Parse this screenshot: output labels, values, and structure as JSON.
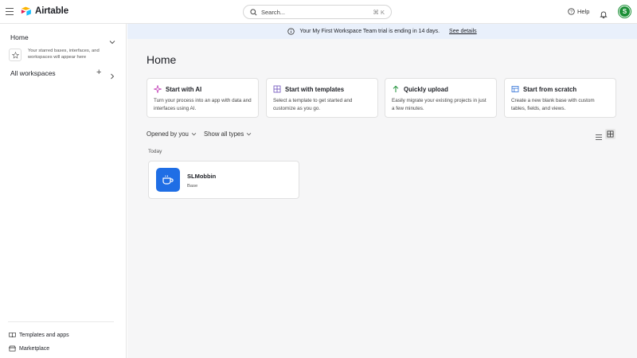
{
  "app": {
    "name": "Airtable"
  },
  "header": {
    "search_placeholder": "Search...",
    "search_shortcut": "⌘ K",
    "help_label": "Help",
    "avatar_initial": "S"
  },
  "sidebar": {
    "home_label": "Home",
    "starred_hint": "Your starred bases, interfaces, and workspaces will appear here",
    "all_workspaces_label": "All workspaces",
    "bottom_links": [
      {
        "label": "Templates and apps",
        "icon": "book-icon"
      },
      {
        "label": "Marketplace",
        "icon": "storefront-icon"
      }
    ]
  },
  "banner": {
    "text": "Your My First Workspace Team trial is ending in 14 days.",
    "link": "See details"
  },
  "main": {
    "title": "Home",
    "cards": [
      {
        "title": "Start with AI",
        "desc": "Turn your process into an app with data and interfaces using AI.",
        "icon": "sparkle-icon"
      },
      {
        "title": "Start with templates",
        "desc": "Select a template to get started and customize as you go.",
        "icon": "grid-icon"
      },
      {
        "title": "Quickly upload",
        "desc": "Easily migrate your existing projects in just a few minutes.",
        "icon": "arrow-up-icon"
      },
      {
        "title": "Start from scratch",
        "desc": "Create a new blank base with custom tables, fields, and views.",
        "icon": "table-icon"
      }
    ],
    "filters": {
      "opened_by": "Opened by you",
      "types": "Show all types"
    },
    "section_today": "Today",
    "bases": [
      {
        "name": "SLMobbin",
        "type": "Base",
        "color": "#1f6ee5",
        "icon": "coffee-cup-icon"
      }
    ]
  },
  "colors": {
    "avatar": "#1b8f36",
    "banner_bg": "#e9f0fb",
    "base_icon": "#1f6ee5",
    "ai_accent": "#c23fb7",
    "upload_accent": "#1b8f36",
    "template_accent": "#6b4fbb",
    "scratch_accent": "#2d6fd6"
  }
}
